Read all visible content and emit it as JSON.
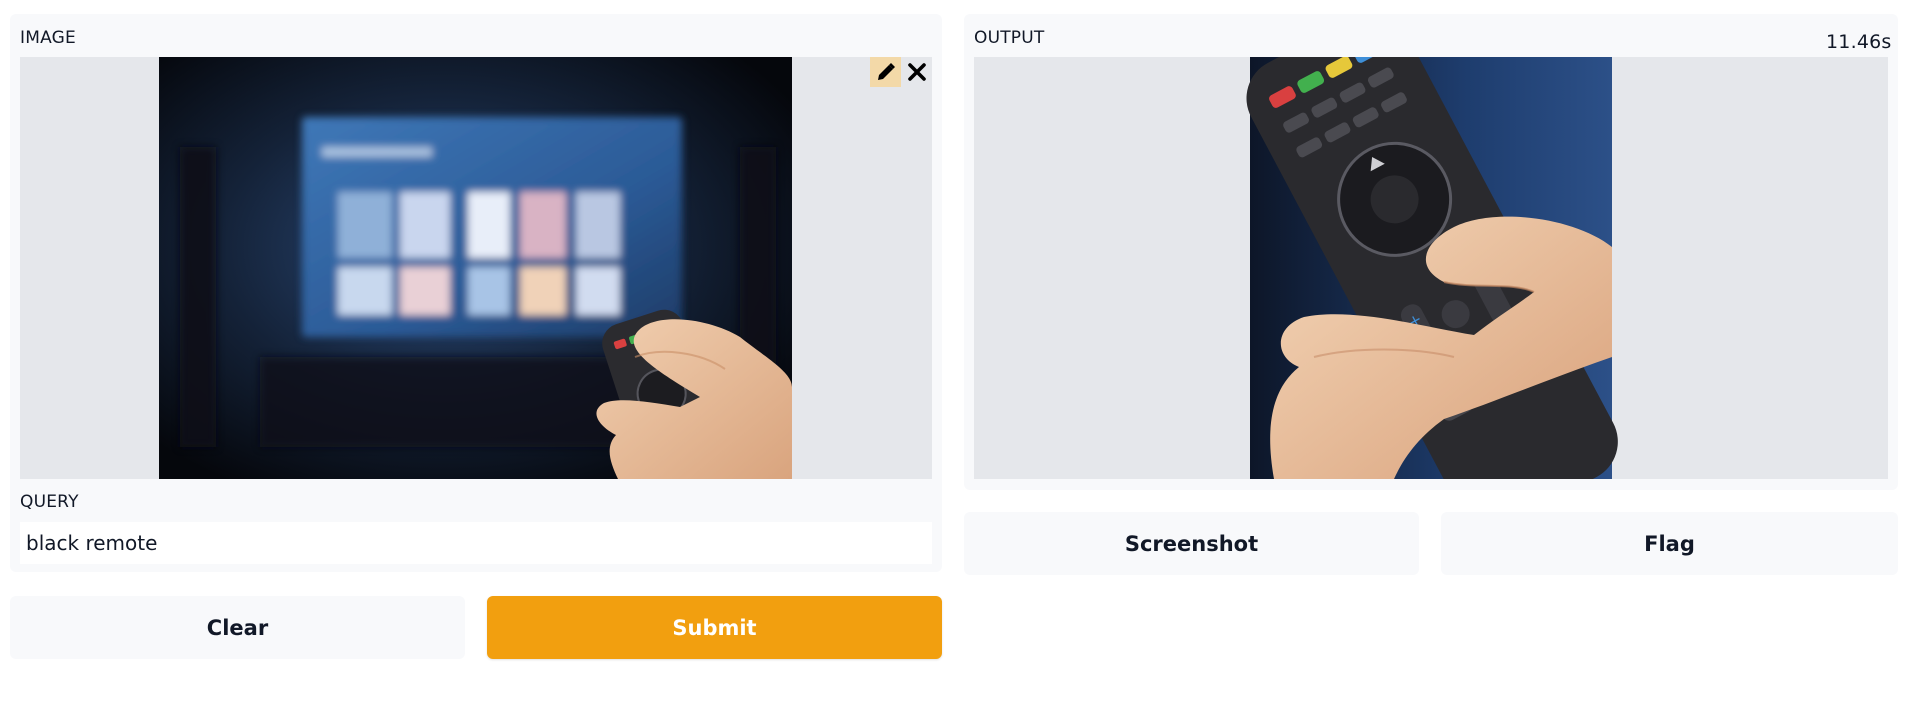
{
  "input_panel": {
    "image_label": "IMAGE",
    "query_label": "QUERY",
    "query_value": "black remote",
    "tools": {
      "edit_icon": "pencil-icon",
      "clear_icon": "close-icon"
    }
  },
  "output_panel": {
    "label": "OUTPUT",
    "timer": "11.46s"
  },
  "buttons": {
    "clear": "Clear",
    "submit": "Submit",
    "screenshot": "Screenshot",
    "flag": "Flag"
  },
  "colors": {
    "accent": "#f29f0f",
    "panel_bg": "#f8f9fb",
    "image_bg": "#e5e7eb",
    "edit_tool_bg": "#f3d9a8"
  }
}
